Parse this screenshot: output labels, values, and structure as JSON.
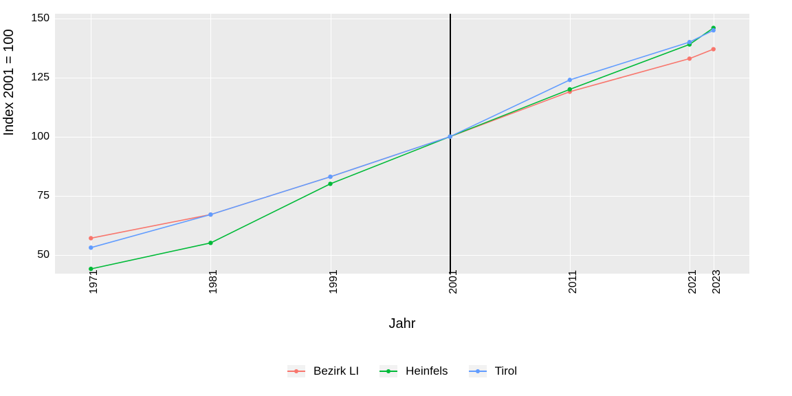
{
  "chart_data": {
    "type": "line",
    "title": "",
    "xlabel": "Jahr",
    "ylabel": "Index 2001 = 100",
    "x": [
      1971,
      1981,
      1991,
      2001,
      2011,
      2021,
      2023
    ],
    "x_ticks": [
      1971,
      1981,
      1991,
      2001,
      2011,
      2021,
      2023
    ],
    "y_ticks": [
      50,
      75,
      100,
      125,
      150
    ],
    "ylim": [
      42,
      152
    ],
    "xlim": [
      1968,
      2026
    ],
    "reference_x": 2001,
    "legend_position": "bottom",
    "grid": true,
    "series": [
      {
        "name": "Bezirk LI",
        "color": "#F8766D",
        "values": [
          57,
          67,
          83,
          100,
          119,
          133,
          137
        ]
      },
      {
        "name": "Heinfels",
        "color": "#00BA38",
        "values": [
          44,
          55,
          80,
          100,
          120,
          139,
          146
        ]
      },
      {
        "name": "Tirol",
        "color": "#619CFF",
        "values": [
          53,
          67,
          83,
          100,
          124,
          140,
          145
        ]
      }
    ]
  }
}
